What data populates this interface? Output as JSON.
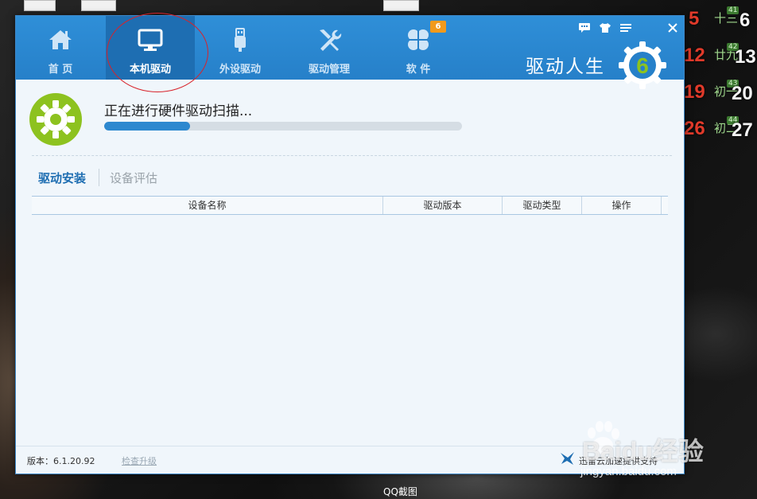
{
  "desktop": {
    "taskbar_label": "QQ截图",
    "calendar": [
      {
        "day": "5",
        "lunar": "十三",
        "week": "41",
        "day2": "6"
      },
      {
        "day": "12",
        "lunar": "廿九",
        "week": "42",
        "day2": "13"
      },
      {
        "day": "19",
        "lunar": "初一",
        "week": "43",
        "day2": "20"
      },
      {
        "day": "26",
        "lunar": "初二",
        "week": "44",
        "day2": "27"
      }
    ]
  },
  "window": {
    "nav": [
      {
        "label": "首 页",
        "icon": "home-icon"
      },
      {
        "label": "本机驱动",
        "icon": "monitor-icon",
        "active": true
      },
      {
        "label": "外设驱动",
        "icon": "usb-icon"
      },
      {
        "label": "驱动管理",
        "icon": "wrench-screwdriver-icon"
      },
      {
        "label": "软 件",
        "icon": "clover-icon",
        "badge": "6"
      }
    ],
    "brand": {
      "name": "驱动人生",
      "logo_number": "6"
    },
    "controls": [
      "feedback-icon",
      "skin-icon",
      "menu-icon",
      "close-icon"
    ]
  },
  "scan": {
    "status_text": "正在进行硬件驱动扫描...",
    "progress": 0.24
  },
  "tabs": [
    {
      "label": "驱动安装",
      "active": true
    },
    {
      "label": "设备评估",
      "active": false
    }
  ],
  "table": {
    "columns": [
      "设备名称",
      "驱动版本",
      "驱动类型",
      "操作"
    ]
  },
  "status": {
    "version": "版本：6.1.20.92",
    "check_update": "检查升级",
    "support": "迅雷云加速提供支持"
  },
  "watermark": {
    "main": "Baidu经验",
    "sub": "jingyan.baidu.com"
  },
  "colors": {
    "accent": "#2680c9",
    "active_nav": "#1e6eb2",
    "brand_green": "#8dc21f",
    "progress": "#2d88cf",
    "badge": "#f29a1c"
  }
}
